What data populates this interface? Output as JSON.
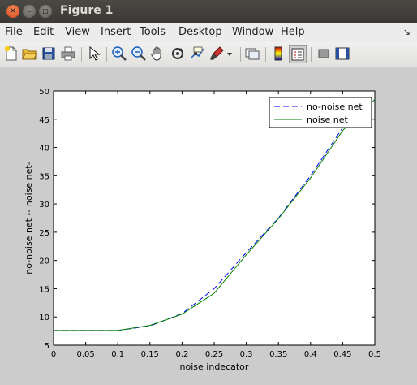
{
  "window": {
    "title": "Figure 1"
  },
  "menu": [
    "File",
    "Edit",
    "View",
    "Insert",
    "Tools",
    "Desktop",
    "Window",
    "Help"
  ],
  "toolbar": {
    "icons": [
      "new-file-icon",
      "open-folder-icon",
      "save-icon",
      "print-icon",
      "pointer-arrow-icon",
      "zoom-in-icon",
      "zoom-out-icon",
      "pan-hand-icon",
      "rotate-3d-icon",
      "data-cursor-icon",
      "brush-icon",
      "brush-dropdown-icon",
      "link-plot-icon",
      "colorbar-icon",
      "legend-icon",
      "hide-plot-tools-icon",
      "show-plot-tools-icon"
    ]
  },
  "colors": {
    "no_noise": "#0000ff",
    "noise": "#007f00"
  },
  "chart_data": {
    "type": "line",
    "title": "",
    "xlabel": "noise indecator",
    "ylabel": "no-noise net -- noise net-",
    "xlim": [
      0,
      0.5
    ],
    "ylim": [
      5,
      50
    ],
    "xticks": [
      0,
      0.05,
      0.1,
      0.15,
      0.2,
      0.25,
      0.3,
      0.35,
      0.4,
      0.45,
      0.5
    ],
    "xtick_labels": [
      "0",
      "0.05",
      "0.1",
      "0.15",
      "0.2",
      "0.25",
      "0.3",
      "0.35",
      "0.4",
      "0.45",
      "0.5"
    ],
    "yticks": [
      5,
      10,
      15,
      20,
      25,
      30,
      35,
      40,
      45,
      50
    ],
    "ytick_labels": [
      "5",
      "10",
      "15",
      "20",
      "25",
      "30",
      "35",
      "40",
      "45",
      "50"
    ],
    "grid": false,
    "legend": "top-right",
    "series": [
      {
        "name": "no-noise net",
        "style": "dashed",
        "color": "#0000ff",
        "x": [
          0,
          0.05,
          0.1,
          0.15,
          0.2,
          0.25,
          0.3,
          0.35,
          0.4,
          0.45,
          0.5
        ],
        "y": [
          7.6,
          7.6,
          7.6,
          8.4,
          10.6,
          15.0,
          21.4,
          27.5,
          35.0,
          43.5,
          48.5
        ]
      },
      {
        "name": "noise net",
        "style": "solid",
        "color": "#007f00",
        "x": [
          0,
          0.05,
          0.1,
          0.15,
          0.2,
          0.25,
          0.3,
          0.35,
          0.4,
          0.45,
          0.5
        ],
        "y": [
          7.6,
          7.6,
          7.6,
          8.5,
          10.5,
          14.2,
          21.0,
          27.4,
          34.6,
          43.0,
          48.5
        ]
      }
    ]
  }
}
